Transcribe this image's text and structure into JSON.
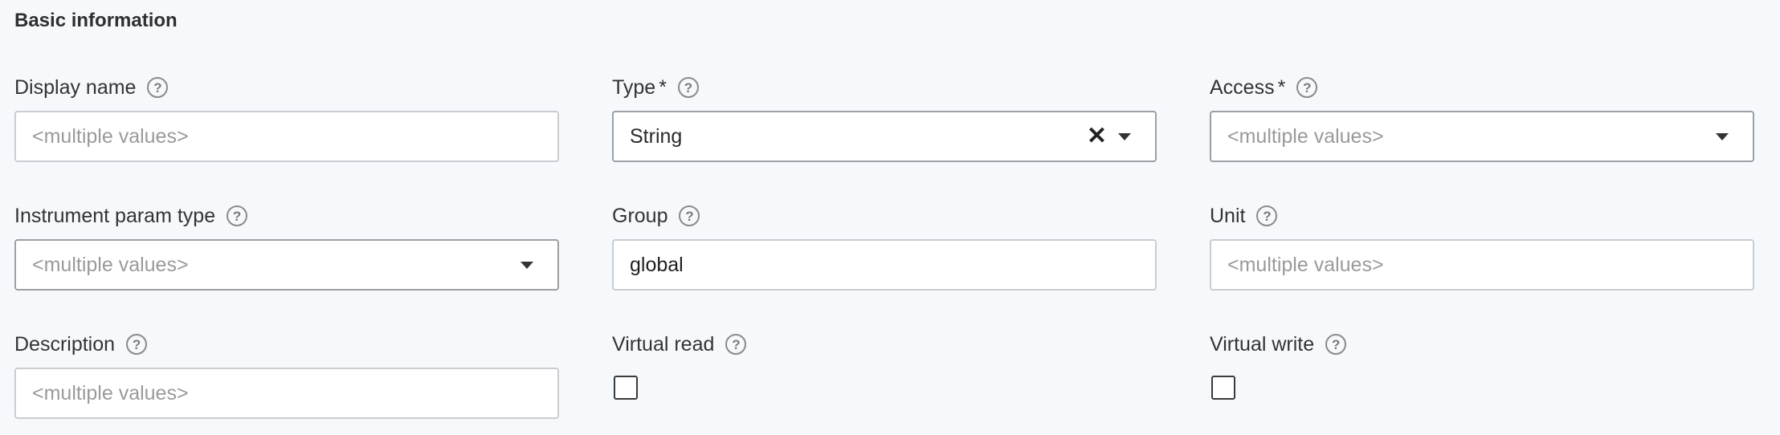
{
  "section": {
    "title": "Basic information"
  },
  "fields": {
    "display_name": {
      "label": "Display name",
      "placeholder": "<multiple values>",
      "value": ""
    },
    "type": {
      "label": "Type",
      "required_mark": "*",
      "value": "String"
    },
    "access": {
      "label": "Access",
      "required_mark": "*",
      "placeholder": "<multiple values>"
    },
    "instrument_param_type": {
      "label": "Instrument param type",
      "placeholder": "<multiple values>"
    },
    "group": {
      "label": "Group",
      "value": "global"
    },
    "unit": {
      "label": "Unit",
      "placeholder": "<multiple values>",
      "value": ""
    },
    "description": {
      "label": "Description",
      "placeholder": "<multiple values>",
      "value": ""
    },
    "virtual_read": {
      "label": "Virtual read",
      "checked": false
    },
    "virtual_write": {
      "label": "Virtual write",
      "checked": false
    }
  },
  "icons": {
    "help": "?",
    "clear": "✕"
  },
  "colors": {
    "background": "#f6f9fc",
    "input_border": "#c9ccd1",
    "placeholder": "#9a9a9a",
    "text": "#333333"
  }
}
